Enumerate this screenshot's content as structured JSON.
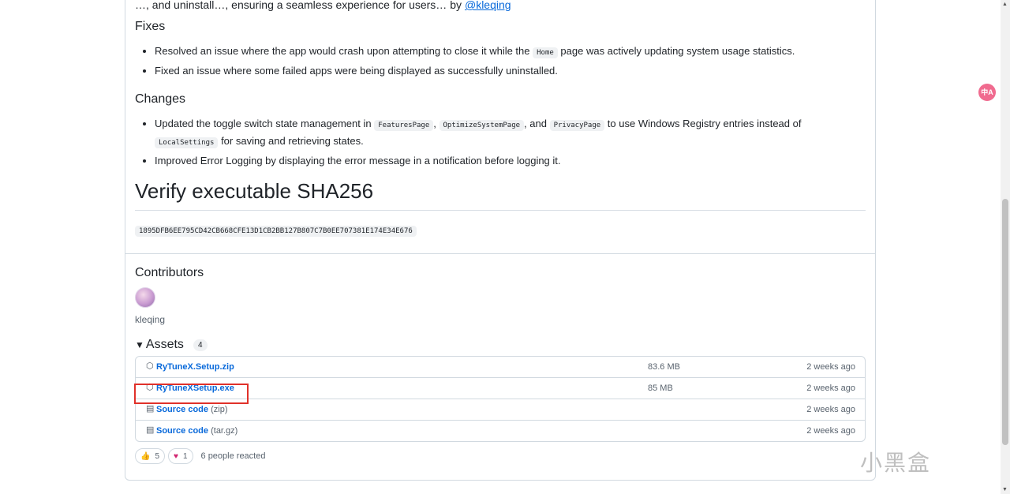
{
  "top_fragment": {
    "text": "…, and uninstall…, ensuring a seamless experience for users… by",
    "link": "@kleqing"
  },
  "fixes": {
    "heading": "Fixes",
    "items": [
      {
        "pre": "Resolved an issue where the app would crash upon attempting to close it while the ",
        "code": "Home",
        "post": " page was actively updating system usage statistics."
      },
      {
        "pre": "Fixed an issue where some failed apps were being displayed as successfully uninstalled.",
        "code": "",
        "post": ""
      }
    ]
  },
  "changes": {
    "heading": "Changes",
    "item1": {
      "t1": "Updated the toggle switch state management in ",
      "c1": "FeaturesPage",
      "t2": ", ",
      "c2": "OptimizeSystemPage",
      "t3": ", and ",
      "c3": "PrivacyPage",
      "t4": " to use Windows Registry entries instead of ",
      "c4": "LocalSettings",
      "t5": " for saving and retrieving states."
    },
    "item2": "Improved Error Logging by displaying the error message in a notification before logging it."
  },
  "verify": {
    "heading": "Verify executable SHA256",
    "hash": "1895DFB6EE795CD42CB668CFE13D1CB2BB127B807C7B0EE707381E174E34E676"
  },
  "contributors": {
    "heading": "Contributors",
    "name": "kleqing"
  },
  "assets": {
    "heading": "Assets",
    "count": "4",
    "rows": [
      {
        "icon": "package-icon",
        "name": "RyTuneX.Setup.zip",
        "ext": "",
        "size": "83.6 MB",
        "date": "2 weeks ago"
      },
      {
        "icon": "package-icon",
        "name": "RyTuneXSetup.exe",
        "ext": "",
        "size": "85 MB",
        "date": "2 weeks ago"
      },
      {
        "icon": "file-zip-icon",
        "name": "Source code",
        "ext": "(zip)",
        "size": "",
        "date": "2 weeks ago"
      },
      {
        "icon": "file-zip-icon",
        "name": "Source code",
        "ext": "(tar.gz)",
        "size": "",
        "date": "2 weeks ago"
      }
    ]
  },
  "reactions": {
    "thumbs": "5",
    "heart": "1",
    "summary": "6 people reacted"
  },
  "translate_button": "中A",
  "watermark": "小黑盒",
  "colors": {
    "link": "#0969da",
    "highlight": "#e0312a",
    "border": "#d1d9e0"
  }
}
